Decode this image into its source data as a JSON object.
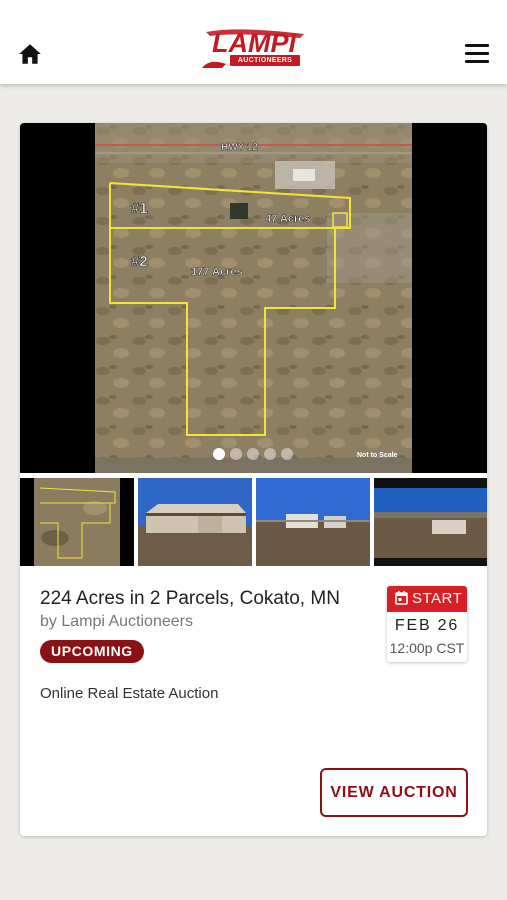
{
  "header": {
    "brand_name": "LAMPI",
    "brand_sub": "AUCTIONEERS",
    "colors": {
      "brand_red": "#c21c22",
      "dark_red": "#8b1114"
    },
    "icons": [
      "home-icon",
      "menu-icon"
    ]
  },
  "listing": {
    "map_labels": {
      "road": "HWY 12",
      "parcel1": "#1",
      "parcel1_acres": "47 Acres",
      "parcel2": "#2",
      "parcel2_acres": "177 Acres",
      "scale_note": "Not to Scale"
    },
    "carousel": {
      "slide_count": 5,
      "active_index": 0
    },
    "thumbnails": [
      "aerial parcel map",
      "pole barn building",
      "storage shed yard",
      "building and field"
    ],
    "title": "224 Acres in 2 Parcels, Cokato, MN",
    "byline": "by Lampi Auctioneers",
    "status": "UPCOMING",
    "subtitle": "Online Real Estate Auction",
    "date": {
      "label": "START",
      "day": "FEB 26",
      "time": "12:00p CST",
      "icon": "calendar-icon"
    },
    "action_label": "VIEW AUCTION"
  }
}
